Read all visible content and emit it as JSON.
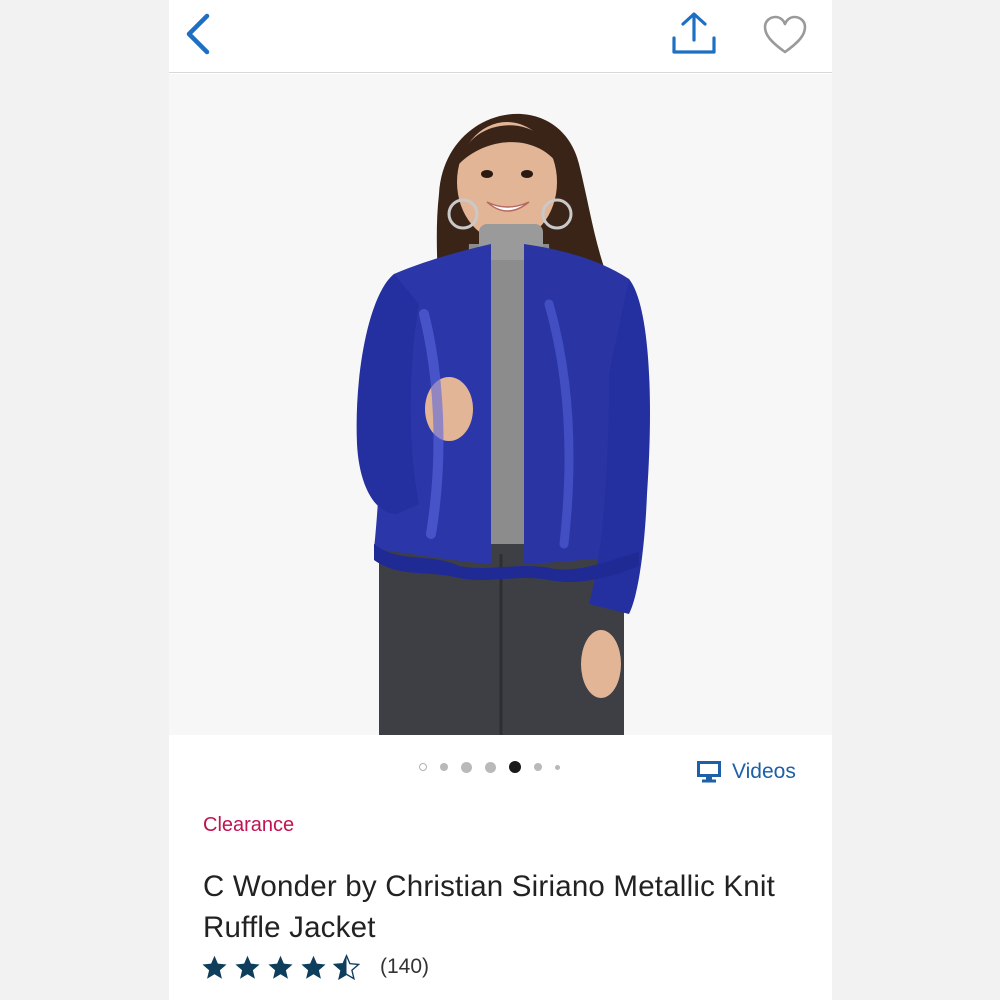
{
  "header": {
    "back_icon": "chevron-left-icon",
    "share_icon": "share-upload-icon",
    "favorite_icon": "heart-outline-icon",
    "accent_color": "#1d6fc4"
  },
  "product_image": {
    "alt": "",
    "carousel": {
      "total": 7,
      "active_index": 4
    }
  },
  "videos": {
    "label": "Videos",
    "icon": "monitor-icon"
  },
  "badge": {
    "label": "Clearance",
    "color": "#c0134f"
  },
  "product": {
    "title": "C Wonder by Christian Siriano Metallic Knit Ruffle Jacket",
    "rating": 4.5,
    "rating_max": 5,
    "review_count": "(140)",
    "star_color": "#0e3e5b"
  }
}
